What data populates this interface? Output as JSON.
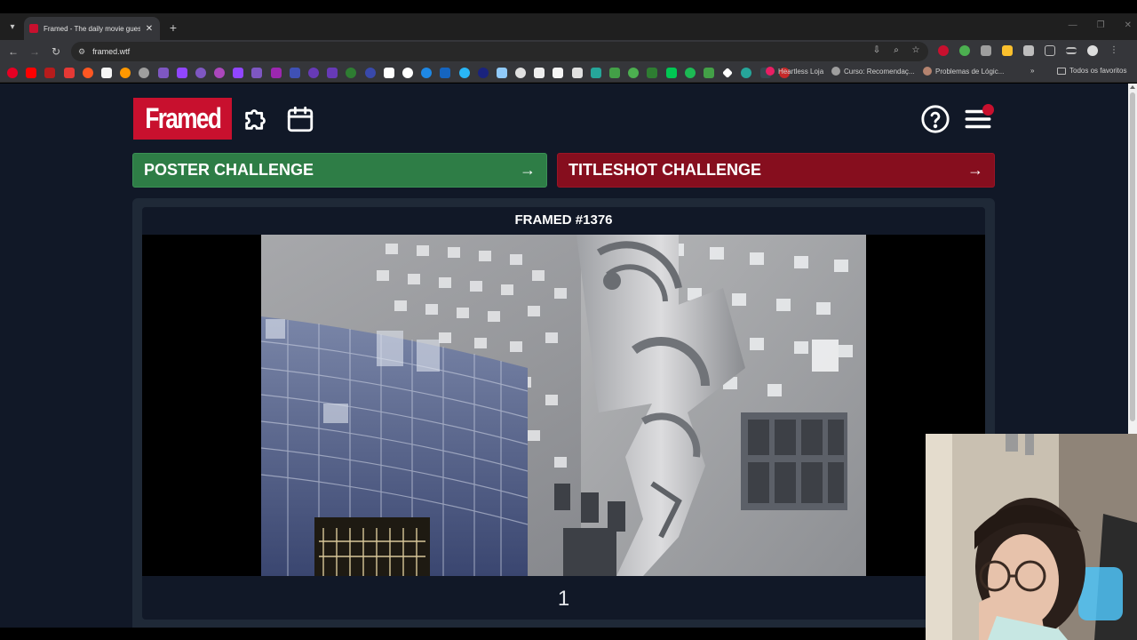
{
  "browser": {
    "tab_title": "Framed - The daily movie gues",
    "url": "framed.wtf",
    "bookmarks": [
      {
        "label": "Heartless Loja",
        "color": "#e91e63"
      },
      {
        "label": "Curso: Recomendaç...",
        "color": "#9e9e9e"
      },
      {
        "label": "Problemas de Lógic...",
        "color": "#b4836f"
      }
    ],
    "all_bookmarks_label": "Todos os favoritos"
  },
  "header": {
    "logo_text": "Framed",
    "icons": [
      "puzzle-icon",
      "calendar-icon",
      "help-icon",
      "menu-icon"
    ]
  },
  "challenges": {
    "poster_label": "POSTER CHALLENGE",
    "poster_arrow": "→",
    "titleshot_label": "TITLESHOT CHALLENGE",
    "titleshot_arrow": "→"
  },
  "game": {
    "title": "FRAMED #1376",
    "frame_number": "1"
  },
  "colors": {
    "brand_red": "#c8102e",
    "poster_green": "#2e7d46",
    "titleshot_red": "#860e1e",
    "page_bg": "#111827",
    "panel_bg": "#1f2937"
  }
}
